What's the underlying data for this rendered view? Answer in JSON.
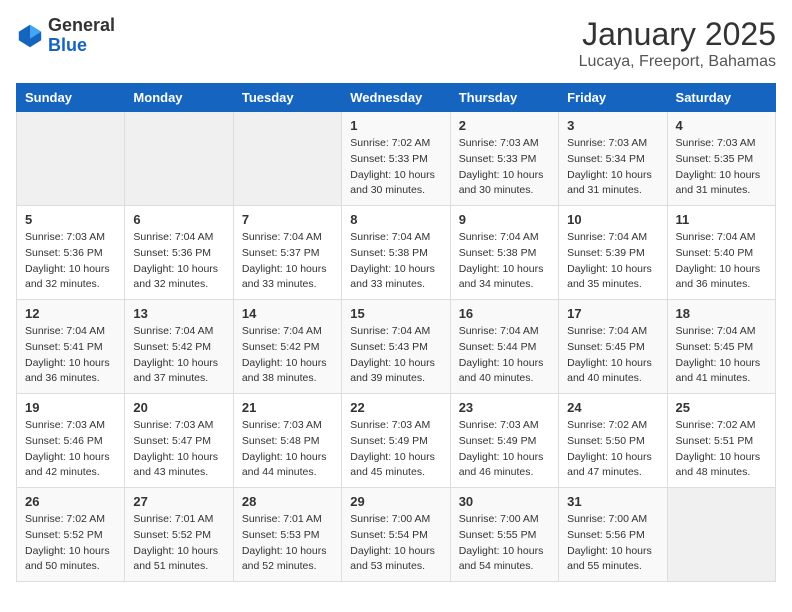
{
  "header": {
    "logo": {
      "general": "General",
      "blue": "Blue"
    },
    "title": "January 2025",
    "subtitle": "Lucaya, Freeport, Bahamas"
  },
  "calendar": {
    "days_of_week": [
      "Sunday",
      "Monday",
      "Tuesday",
      "Wednesday",
      "Thursday",
      "Friday",
      "Saturday"
    ],
    "weeks": [
      [
        {
          "day": "",
          "info": ""
        },
        {
          "day": "",
          "info": ""
        },
        {
          "day": "",
          "info": ""
        },
        {
          "day": "1",
          "info": "Sunrise: 7:02 AM\nSunset: 5:33 PM\nDaylight: 10 hours\nand 30 minutes."
        },
        {
          "day": "2",
          "info": "Sunrise: 7:03 AM\nSunset: 5:33 PM\nDaylight: 10 hours\nand 30 minutes."
        },
        {
          "day": "3",
          "info": "Sunrise: 7:03 AM\nSunset: 5:34 PM\nDaylight: 10 hours\nand 31 minutes."
        },
        {
          "day": "4",
          "info": "Sunrise: 7:03 AM\nSunset: 5:35 PM\nDaylight: 10 hours\nand 31 minutes."
        }
      ],
      [
        {
          "day": "5",
          "info": "Sunrise: 7:03 AM\nSunset: 5:36 PM\nDaylight: 10 hours\nand 32 minutes."
        },
        {
          "day": "6",
          "info": "Sunrise: 7:04 AM\nSunset: 5:36 PM\nDaylight: 10 hours\nand 32 minutes."
        },
        {
          "day": "7",
          "info": "Sunrise: 7:04 AM\nSunset: 5:37 PM\nDaylight: 10 hours\nand 33 minutes."
        },
        {
          "day": "8",
          "info": "Sunrise: 7:04 AM\nSunset: 5:38 PM\nDaylight: 10 hours\nand 33 minutes."
        },
        {
          "day": "9",
          "info": "Sunrise: 7:04 AM\nSunset: 5:38 PM\nDaylight: 10 hours\nand 34 minutes."
        },
        {
          "day": "10",
          "info": "Sunrise: 7:04 AM\nSunset: 5:39 PM\nDaylight: 10 hours\nand 35 minutes."
        },
        {
          "day": "11",
          "info": "Sunrise: 7:04 AM\nSunset: 5:40 PM\nDaylight: 10 hours\nand 36 minutes."
        }
      ],
      [
        {
          "day": "12",
          "info": "Sunrise: 7:04 AM\nSunset: 5:41 PM\nDaylight: 10 hours\nand 36 minutes."
        },
        {
          "day": "13",
          "info": "Sunrise: 7:04 AM\nSunset: 5:42 PM\nDaylight: 10 hours\nand 37 minutes."
        },
        {
          "day": "14",
          "info": "Sunrise: 7:04 AM\nSunset: 5:42 PM\nDaylight: 10 hours\nand 38 minutes."
        },
        {
          "day": "15",
          "info": "Sunrise: 7:04 AM\nSunset: 5:43 PM\nDaylight: 10 hours\nand 39 minutes."
        },
        {
          "day": "16",
          "info": "Sunrise: 7:04 AM\nSunset: 5:44 PM\nDaylight: 10 hours\nand 40 minutes."
        },
        {
          "day": "17",
          "info": "Sunrise: 7:04 AM\nSunset: 5:45 PM\nDaylight: 10 hours\nand 40 minutes."
        },
        {
          "day": "18",
          "info": "Sunrise: 7:04 AM\nSunset: 5:45 PM\nDaylight: 10 hours\nand 41 minutes."
        }
      ],
      [
        {
          "day": "19",
          "info": "Sunrise: 7:03 AM\nSunset: 5:46 PM\nDaylight: 10 hours\nand 42 minutes."
        },
        {
          "day": "20",
          "info": "Sunrise: 7:03 AM\nSunset: 5:47 PM\nDaylight: 10 hours\nand 43 minutes."
        },
        {
          "day": "21",
          "info": "Sunrise: 7:03 AM\nSunset: 5:48 PM\nDaylight: 10 hours\nand 44 minutes."
        },
        {
          "day": "22",
          "info": "Sunrise: 7:03 AM\nSunset: 5:49 PM\nDaylight: 10 hours\nand 45 minutes."
        },
        {
          "day": "23",
          "info": "Sunrise: 7:03 AM\nSunset: 5:49 PM\nDaylight: 10 hours\nand 46 minutes."
        },
        {
          "day": "24",
          "info": "Sunrise: 7:02 AM\nSunset: 5:50 PM\nDaylight: 10 hours\nand 47 minutes."
        },
        {
          "day": "25",
          "info": "Sunrise: 7:02 AM\nSunset: 5:51 PM\nDaylight: 10 hours\nand 48 minutes."
        }
      ],
      [
        {
          "day": "26",
          "info": "Sunrise: 7:02 AM\nSunset: 5:52 PM\nDaylight: 10 hours\nand 50 minutes."
        },
        {
          "day": "27",
          "info": "Sunrise: 7:01 AM\nSunset: 5:52 PM\nDaylight: 10 hours\nand 51 minutes."
        },
        {
          "day": "28",
          "info": "Sunrise: 7:01 AM\nSunset: 5:53 PM\nDaylight: 10 hours\nand 52 minutes."
        },
        {
          "day": "29",
          "info": "Sunrise: 7:00 AM\nSunset: 5:54 PM\nDaylight: 10 hours\nand 53 minutes."
        },
        {
          "day": "30",
          "info": "Sunrise: 7:00 AM\nSunset: 5:55 PM\nDaylight: 10 hours\nand 54 minutes."
        },
        {
          "day": "31",
          "info": "Sunrise: 7:00 AM\nSunset: 5:56 PM\nDaylight: 10 hours\nand 55 minutes."
        },
        {
          "day": "",
          "info": ""
        }
      ]
    ]
  }
}
